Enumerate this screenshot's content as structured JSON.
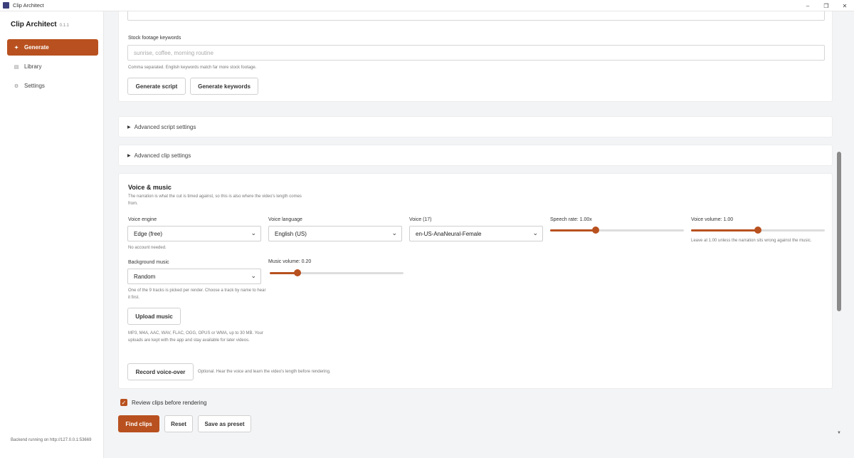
{
  "window": {
    "title": "Clip Architect"
  },
  "sidebar": {
    "brand": "Clip Architect",
    "version": "0.1.1",
    "items": [
      {
        "icon": "sparkle-icon",
        "label": "Generate",
        "active": true
      },
      {
        "icon": "library-icon",
        "label": "Library",
        "active": false
      },
      {
        "icon": "settings-icon",
        "label": "Settings",
        "active": false
      }
    ],
    "backend_status": "Backend running on http://127.0.0.1:53669"
  },
  "script_card": {
    "stock_label": "Stock footage keywords",
    "stock_placeholder": "sunrise, coffee, morning routine",
    "stock_hint": "Comma separated. English keywords match far more stock footage.",
    "generate_script_label": "Generate script",
    "generate_keywords_label": "Generate keywords"
  },
  "advanced_script": {
    "label": "Advanced script settings"
  },
  "advanced_clip": {
    "label": "Advanced clip settings"
  },
  "voice_music": {
    "title": "Voice & music",
    "description": "The narration is what the cut is timed against, so this is also where the video's length comes from.",
    "voice_engine_label": "Voice engine",
    "voice_engine_value": "Edge (free)",
    "voice_engine_hint": "No account needed.",
    "voice_language_label": "Voice language",
    "voice_language_value": "English (US)",
    "voice_label": "Voice (17)",
    "voice_value": "en-US-AnaNeural-Female",
    "speech_rate_label": "Speech rate: 1.00x",
    "speech_rate_fraction": 0.34,
    "voice_volume_label": "Voice volume: 1.00",
    "voice_volume_fraction": 0.5,
    "voice_volume_hint": "Leave at 1.00 unless the narration sits wrong against the music.",
    "bg_music_label": "Background music",
    "bg_music_value": "Random",
    "bg_music_hint": "One of the 9 tracks is picked per render. Choose a track by name to hear it first.",
    "music_volume_label": "Music volume: 0.20",
    "music_volume_fraction": 0.21,
    "upload_music_label": "Upload music",
    "upload_hint": "MP3, M4A, AAC, WAV, FLAC, OGG, OPUS or WMA, up to 30 MB. Your uploads are kept with the app and stay available for later videos.",
    "record_voiceover_label": "Record voice-over",
    "record_hint": "Optional. Hear the voice and learn the video's length before rendering."
  },
  "footer": {
    "review_label": "Review clips before rendering",
    "review_checked": true,
    "find_clips_label": "Find clips",
    "reset_label": "Reset",
    "save_preset_label": "Save as preset"
  },
  "colors": {
    "accent": "#b8511f"
  }
}
